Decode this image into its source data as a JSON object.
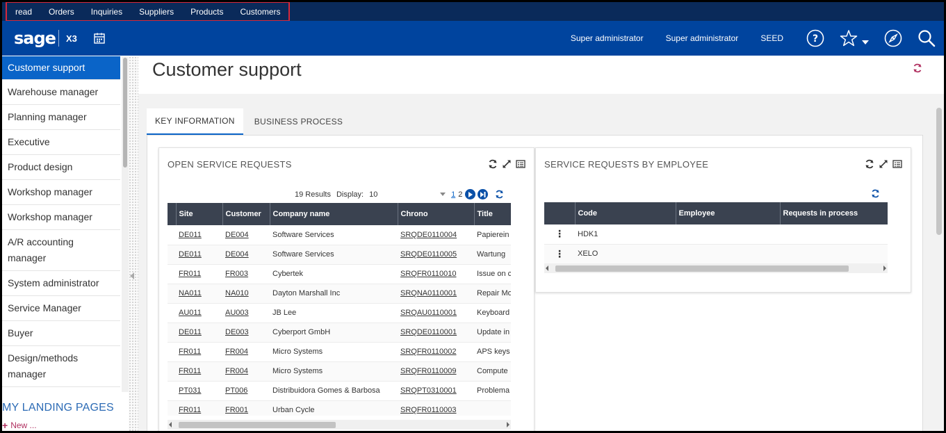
{
  "top_menu": [
    "read",
    "Orders",
    "Inquiries",
    "Suppliers",
    "Products",
    "Customers"
  ],
  "header": {
    "logo": "sage",
    "product": "X3",
    "user1": "Super administrator",
    "user2": "Super administrator",
    "folder": "SEED"
  },
  "sidebar": {
    "items": [
      "Customer support",
      "Warehouse manager",
      "Planning manager",
      "Executive",
      "Product design",
      "Workshop manager",
      "Workshop manager",
      "A/R accounting manager",
      "System administrator",
      "Service Manager",
      "Buyer",
      "Design/methods manager"
    ],
    "landing_title": "MY LANDING PAGES",
    "new_label": "New ..."
  },
  "page": {
    "title": "Customer support"
  },
  "tabs": [
    "KEY INFORMATION",
    "BUSINESS PROCESS"
  ],
  "open_requests": {
    "title": "OPEN SERVICE REQUESTS",
    "results": "19 Results",
    "display_label": "Display:",
    "display_value": "10",
    "page1": "1",
    "page2": "2",
    "columns": [
      "Site",
      "Customer",
      "Company name",
      "Chrono",
      "Title"
    ],
    "rows": [
      [
        "DE011",
        "DE004",
        "Software Services",
        "SRQDE0110004",
        "Papierein"
      ],
      [
        "DE011",
        "DE004",
        "Software Services",
        "SRQDE0110005",
        "Wartung"
      ],
      [
        "FR011",
        "FR003",
        "Cybertek",
        "SRQFR0110010",
        "Issue on c"
      ],
      [
        "NA011",
        "NA010",
        "Dayton Marshall Inc",
        "SRQNA0110001",
        "Repair Mo"
      ],
      [
        "AU011",
        "AU003",
        "JB Lee",
        "SRQAU0110001",
        "Keyboard"
      ],
      [
        "DE011",
        "DE003",
        "Cyberport GmbH",
        "SRQDE0110001",
        "Update in"
      ],
      [
        "FR011",
        "FR004",
        "Micro Systems",
        "SRQFR0110002",
        "APS keys"
      ],
      [
        "FR011",
        "FR004",
        "Micro Systems",
        "SRQFR0110009",
        "Compute"
      ],
      [
        "PT031",
        "PT006",
        "Distribuidora Gomes & Barbosa",
        "SRQPT0310001",
        "Problema"
      ],
      [
        "FR011",
        "FR001",
        "Urban Cycle",
        "SRQFR0110003",
        ""
      ]
    ]
  },
  "by_employee": {
    "title": "SERVICE REQUESTS BY EMPLOYEE",
    "columns": [
      "Code",
      "Employee",
      "Requests in process"
    ],
    "rows": [
      [
        "HDK1",
        "",
        ""
      ],
      [
        "XELO",
        "",
        ""
      ]
    ]
  },
  "colors": {
    "top_strip": "#0a2a5a",
    "header": "#00449e",
    "active": "#0a64c8",
    "grid_header": "#3a4250",
    "refresh_accent": "#b03060"
  }
}
